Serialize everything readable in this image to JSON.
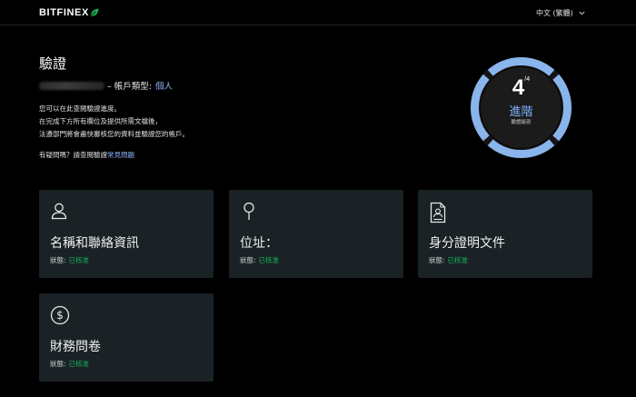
{
  "brand": {
    "name": "BITFINEX"
  },
  "header": {
    "language": "中文 (繁體)"
  },
  "main": {
    "title": "驗證",
    "account_type_label": "– 帳戶類型:",
    "account_type_value": "個人",
    "intro_lines": [
      "您可以在此查閱驗證進度。",
      "在完成下方所有欄位及提供所需文檔後，",
      "法遵部門將會盡快審核您的資料並驗證您的帳戶。"
    ],
    "help_text": "有疑問嗎？請查閱驗證",
    "help_link": "常見問題"
  },
  "gauge": {
    "level": "4",
    "level_max": "/4",
    "level_name": "進階",
    "caption": "驗證級別",
    "progress": 1.0,
    "color_ring": "#8ab4ec",
    "color_inner": "#1a1a1a"
  },
  "cards": [
    {
      "title": "名稱和聯絡資訊",
      "status_label": "狀態:",
      "status_value": "已核准",
      "icon": "person-icon"
    },
    {
      "title": "位址：",
      "status_label": "狀態:",
      "status_value": "已核准",
      "icon": "location-pin-icon"
    },
    {
      "title": "身分證明文件",
      "status_label": "狀態:",
      "status_value": "已核准",
      "icon": "id-document-icon"
    },
    {
      "title": "財務問卷",
      "status_label": "狀態:",
      "status_value": "已核准",
      "icon": "dollar-circle-icon"
    }
  ],
  "colors": {
    "background": "#000000",
    "card": "#1a2226",
    "link": "#8fb4ff",
    "approved": "#16b157",
    "brand_leaf": "#16b157"
  }
}
